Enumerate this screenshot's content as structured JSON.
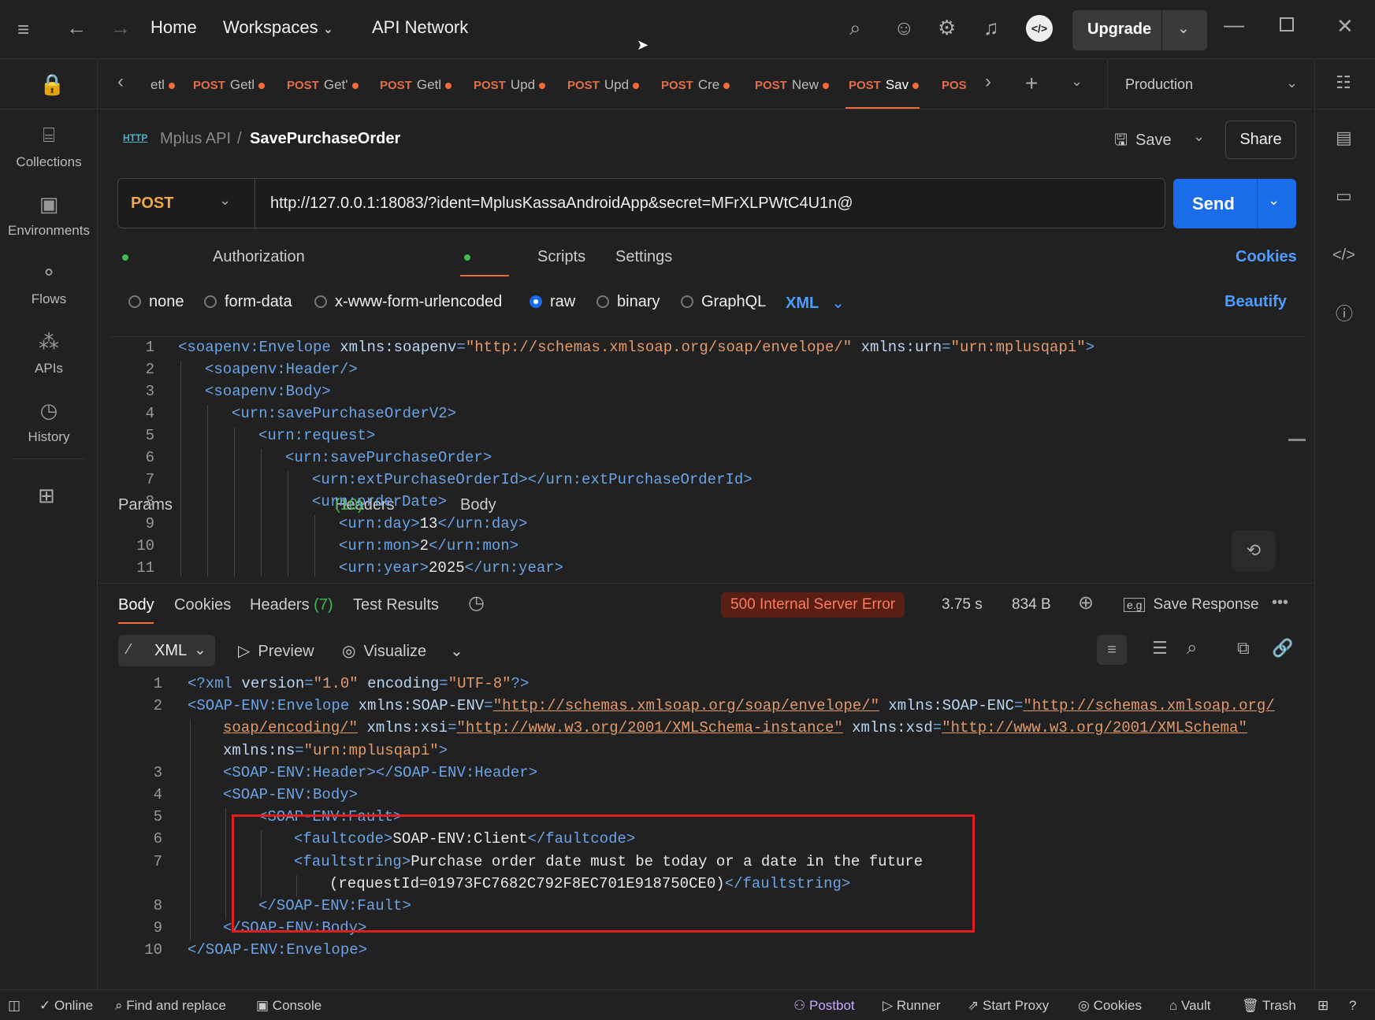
{
  "topbar": {
    "home": "Home",
    "workspaces": "Workspaces",
    "api_network": "API Network",
    "upgrade": "Upgrade"
  },
  "sidebar": {
    "collections": "Collections",
    "environments": "Environments",
    "flows": "Flows",
    "apis": "APIs",
    "history": "History"
  },
  "tabs": [
    {
      "method": "",
      "name": "etl"
    },
    {
      "method": "POST",
      "name": "Getl"
    },
    {
      "method": "POST",
      "name": "Get'"
    },
    {
      "method": "POST",
      "name": "Getl"
    },
    {
      "method": "POST",
      "name": "Upd"
    },
    {
      "method": "POST",
      "name": "Upd"
    },
    {
      "method": "POST",
      "name": "Cre"
    },
    {
      "method": "POST",
      "name": "New"
    },
    {
      "method": "POST",
      "name": "Sav"
    },
    {
      "method": "POS",
      "name": ""
    }
  ],
  "environment": "Production",
  "breadcrumb": {
    "collection": "Mplus API",
    "sep": "/",
    "request": "SavePurchaseOrder",
    "http_icon": "HTTP"
  },
  "actions": {
    "save": "Save",
    "share": "Share"
  },
  "request": {
    "method": "POST",
    "url": "http://127.0.0.1:18083/?ident=MplusKassaAndroidApp&secret=MFrXLPWtC4U1n@",
    "send": "Send"
  },
  "req_tabs": {
    "params": "Params",
    "authorization": "Authorization",
    "headers": "Headers",
    "headers_count": "(10)",
    "body": "Body",
    "scripts": "Scripts",
    "settings": "Settings",
    "cookies": "Cookies"
  },
  "body_types": {
    "none": "none",
    "form_data": "form-data",
    "urlencoded": "x-www-form-urlencoded",
    "raw": "raw",
    "binary": "binary",
    "graphql": "GraphQL",
    "format": "XML",
    "beautify": "Beautify"
  },
  "request_body": [
    {
      "n": "1",
      "indent": 0,
      "parts": [
        [
          "t",
          "<soapenv:Envelope "
        ],
        [
          "a",
          "xmlns:soapenv"
        ],
        [
          "t",
          "="
        ],
        [
          "s",
          "\"http://schemas.xmlsoap.org/soap/envelope/\""
        ],
        [
          "t",
          " "
        ],
        [
          "a",
          "xmlns:urn"
        ],
        [
          "t",
          "="
        ],
        [
          "s",
          "\"urn:mplusqapi\""
        ],
        [
          "t",
          ">"
        ]
      ]
    },
    {
      "n": "2",
      "indent": 1,
      "parts": [
        [
          "t",
          "<soapenv:Header/>"
        ]
      ]
    },
    {
      "n": "3",
      "indent": 1,
      "parts": [
        [
          "t",
          "<soapenv:Body>"
        ]
      ]
    },
    {
      "n": "4",
      "indent": 2,
      "parts": [
        [
          "t",
          "<urn:savePurchaseOrderV2>"
        ]
      ]
    },
    {
      "n": "5",
      "indent": 3,
      "parts": [
        [
          "t",
          "<urn:request>"
        ]
      ]
    },
    {
      "n": "6",
      "indent": 4,
      "parts": [
        [
          "t",
          "<urn:savePurchaseOrder>"
        ]
      ]
    },
    {
      "n": "7",
      "indent": 5,
      "parts": [
        [
          "t",
          "<urn:extPurchaseOrderId></urn:extPurchaseOrderId>"
        ]
      ]
    },
    {
      "n": "8",
      "indent": 5,
      "parts": [
        [
          "t",
          "<urn:orderDate>"
        ]
      ]
    },
    {
      "n": "9",
      "indent": 6,
      "parts": [
        [
          "t",
          "<urn:day>"
        ],
        [
          "tx",
          "13"
        ],
        [
          "t",
          "</urn:day>"
        ]
      ]
    },
    {
      "n": "10",
      "indent": 6,
      "parts": [
        [
          "t",
          "<urn:mon>"
        ],
        [
          "tx",
          "2"
        ],
        [
          "t",
          "</urn:mon>"
        ]
      ]
    },
    {
      "n": "11",
      "indent": 6,
      "parts": [
        [
          "t",
          "<urn:year>"
        ],
        [
          "tx",
          "2025"
        ],
        [
          "t",
          "</urn:year>"
        ]
      ]
    }
  ],
  "resp_tabs": {
    "body": "Body",
    "cookies": "Cookies",
    "headers": "Headers",
    "headers_count": "(7)",
    "test_results": "Test Results"
  },
  "response_meta": {
    "status": "500 Internal Server Error",
    "time": "3.75 s",
    "size": "834 B",
    "save_response": "Save Response"
  },
  "resp_toolbar": {
    "format": "XML",
    "preview": "Preview",
    "visualize": "Visualize"
  },
  "response_body": [
    {
      "n": "1",
      "indent": 0,
      "parts": [
        [
          "t",
          "<?xml "
        ],
        [
          "a",
          "version"
        ],
        [
          "t",
          "="
        ],
        [
          "s",
          "\"1.0\""
        ],
        [
          "t",
          " "
        ],
        [
          "a",
          "encoding"
        ],
        [
          "t",
          "="
        ],
        [
          "s",
          "\"UTF-8\""
        ],
        [
          "t",
          "?>"
        ]
      ]
    },
    {
      "n": "2",
      "indent": 0,
      "parts": [
        [
          "t",
          "<SOAP-ENV:Envelope "
        ],
        [
          "a",
          "xmlns:SOAP-ENV"
        ],
        [
          "t",
          "="
        ],
        [
          "s",
          "\"http://schemas.xmlsoap.org/soap/envelope/\""
        ],
        [
          "t",
          " "
        ],
        [
          "a",
          "xmlns:SOAP-ENC"
        ],
        [
          "t",
          "="
        ],
        [
          "s",
          "\"http://schemas.xmlsoap.org/"
        ]
      ]
    },
    {
      "n": "",
      "indent": 1,
      "parts": [
        [
          "s",
          "soap/encoding/\""
        ],
        [
          "t",
          " "
        ],
        [
          "a",
          "xmlns:xsi"
        ],
        [
          "t",
          "="
        ],
        [
          "s",
          "\"http://www.w3.org/2001/XMLSchema-instance\""
        ],
        [
          "t",
          " "
        ],
        [
          "a",
          "xmlns:xsd"
        ],
        [
          "t",
          "="
        ],
        [
          "s",
          "\"http://www.w3.org/2001/XMLSchema\""
        ]
      ]
    },
    {
      "n": "",
      "indent": 1,
      "parts": [
        [
          "a",
          "xmlns:ns"
        ],
        [
          "t",
          "="
        ],
        [
          "s",
          "\"urn:mplusqapi\""
        ],
        [
          "t",
          ">"
        ]
      ]
    },
    {
      "n": "3",
      "indent": 1,
      "parts": [
        [
          "t",
          "<SOAP-ENV:Header></SOAP-ENV:Header>"
        ]
      ]
    },
    {
      "n": "4",
      "indent": 1,
      "parts": [
        [
          "t",
          "<SOAP-ENV:Body>"
        ]
      ]
    },
    {
      "n": "5",
      "indent": 2,
      "parts": [
        [
          "t",
          "<SOAP-ENV:Fault>"
        ]
      ]
    },
    {
      "n": "6",
      "indent": 3,
      "parts": [
        [
          "t",
          "<faultcode>"
        ],
        [
          "tx",
          "SOAP-ENV:Client"
        ],
        [
          "t",
          "</faultcode>"
        ]
      ]
    },
    {
      "n": "7",
      "indent": 3,
      "parts": [
        [
          "t",
          "<faultstring>"
        ],
        [
          "tx",
          "Purchase order date must be today or a date in the future"
        ]
      ]
    },
    {
      "n": "",
      "indent": 4,
      "parts": [
        [
          "tx",
          "(requestId=01973FC7682C792F8EC701E918750CE0)"
        ],
        [
          "t",
          "</faultstring>"
        ]
      ]
    },
    {
      "n": "8",
      "indent": 2,
      "parts": [
        [
          "t",
          "</SOAP-ENV:Fault>"
        ]
      ]
    },
    {
      "n": "9",
      "indent": 1,
      "parts": [
        [
          "t",
          "</SOAP-ENV:Body>"
        ]
      ]
    },
    {
      "n": "10",
      "indent": 0,
      "parts": [
        [
          "t",
          "</SOAP-ENV:Envelope>"
        ]
      ]
    }
  ],
  "statusbar": {
    "online": "Online",
    "find": "Find and replace",
    "console": "Console",
    "postbot": "Postbot",
    "runner": "Runner",
    "proxy": "Start Proxy",
    "cookies": "Cookies",
    "vault": "Vault",
    "trash": "Trash"
  },
  "colors": {
    "accent": "#1a6ce8",
    "error": "#ff7a5c",
    "method": "#e26e49",
    "highlight": "#e01e1e"
  }
}
